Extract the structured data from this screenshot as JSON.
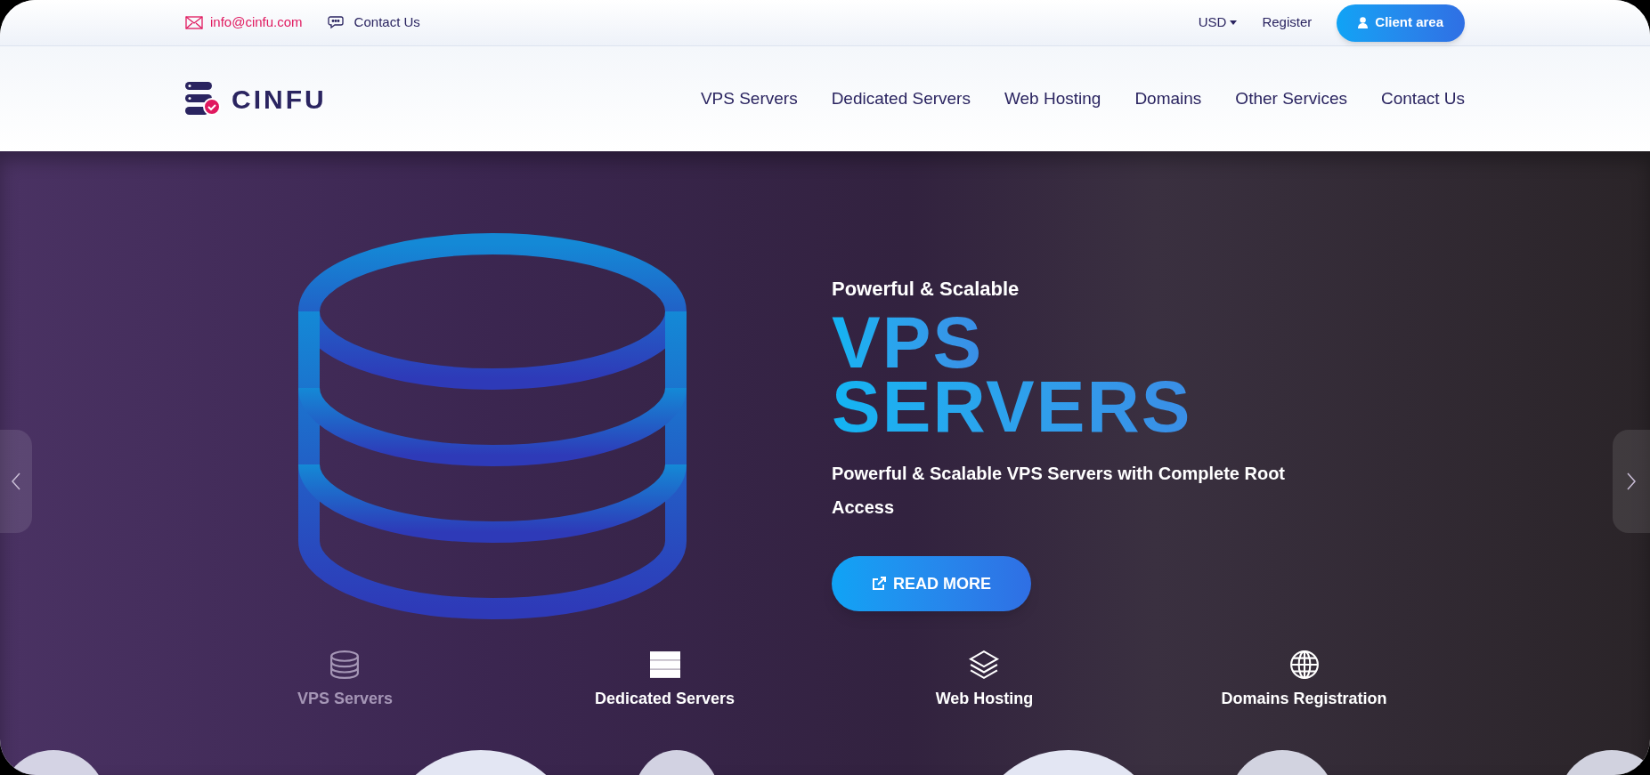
{
  "top_bar": {
    "email": "info@cinfu.com",
    "contact": "Contact Us",
    "currency": "USD",
    "register": "Register",
    "client_area": "Client area"
  },
  "header": {
    "logo_text": "CINFU",
    "nav": [
      {
        "label": "VPS Servers"
      },
      {
        "label": "Dedicated Servers"
      },
      {
        "label": "Web Hosting"
      },
      {
        "label": "Domains"
      },
      {
        "label": "Other Services"
      },
      {
        "label": "Contact Us"
      }
    ]
  },
  "hero": {
    "eyebrow": "Powerful & Scalable",
    "title_lines": [
      "VPS",
      "SERVERS"
    ],
    "description": "Powerful & Scalable VPS Servers with Complete Root Access",
    "button": "READ MORE",
    "tabs": [
      {
        "kind": "database",
        "label": "VPS Servers",
        "selected": true
      },
      {
        "kind": "server",
        "label": "Dedicated Servers",
        "selected": false
      },
      {
        "kind": "layers",
        "label": "Web Hosting",
        "selected": false
      },
      {
        "kind": "globe",
        "label": "Domains Registration",
        "selected": false
      }
    ]
  }
}
